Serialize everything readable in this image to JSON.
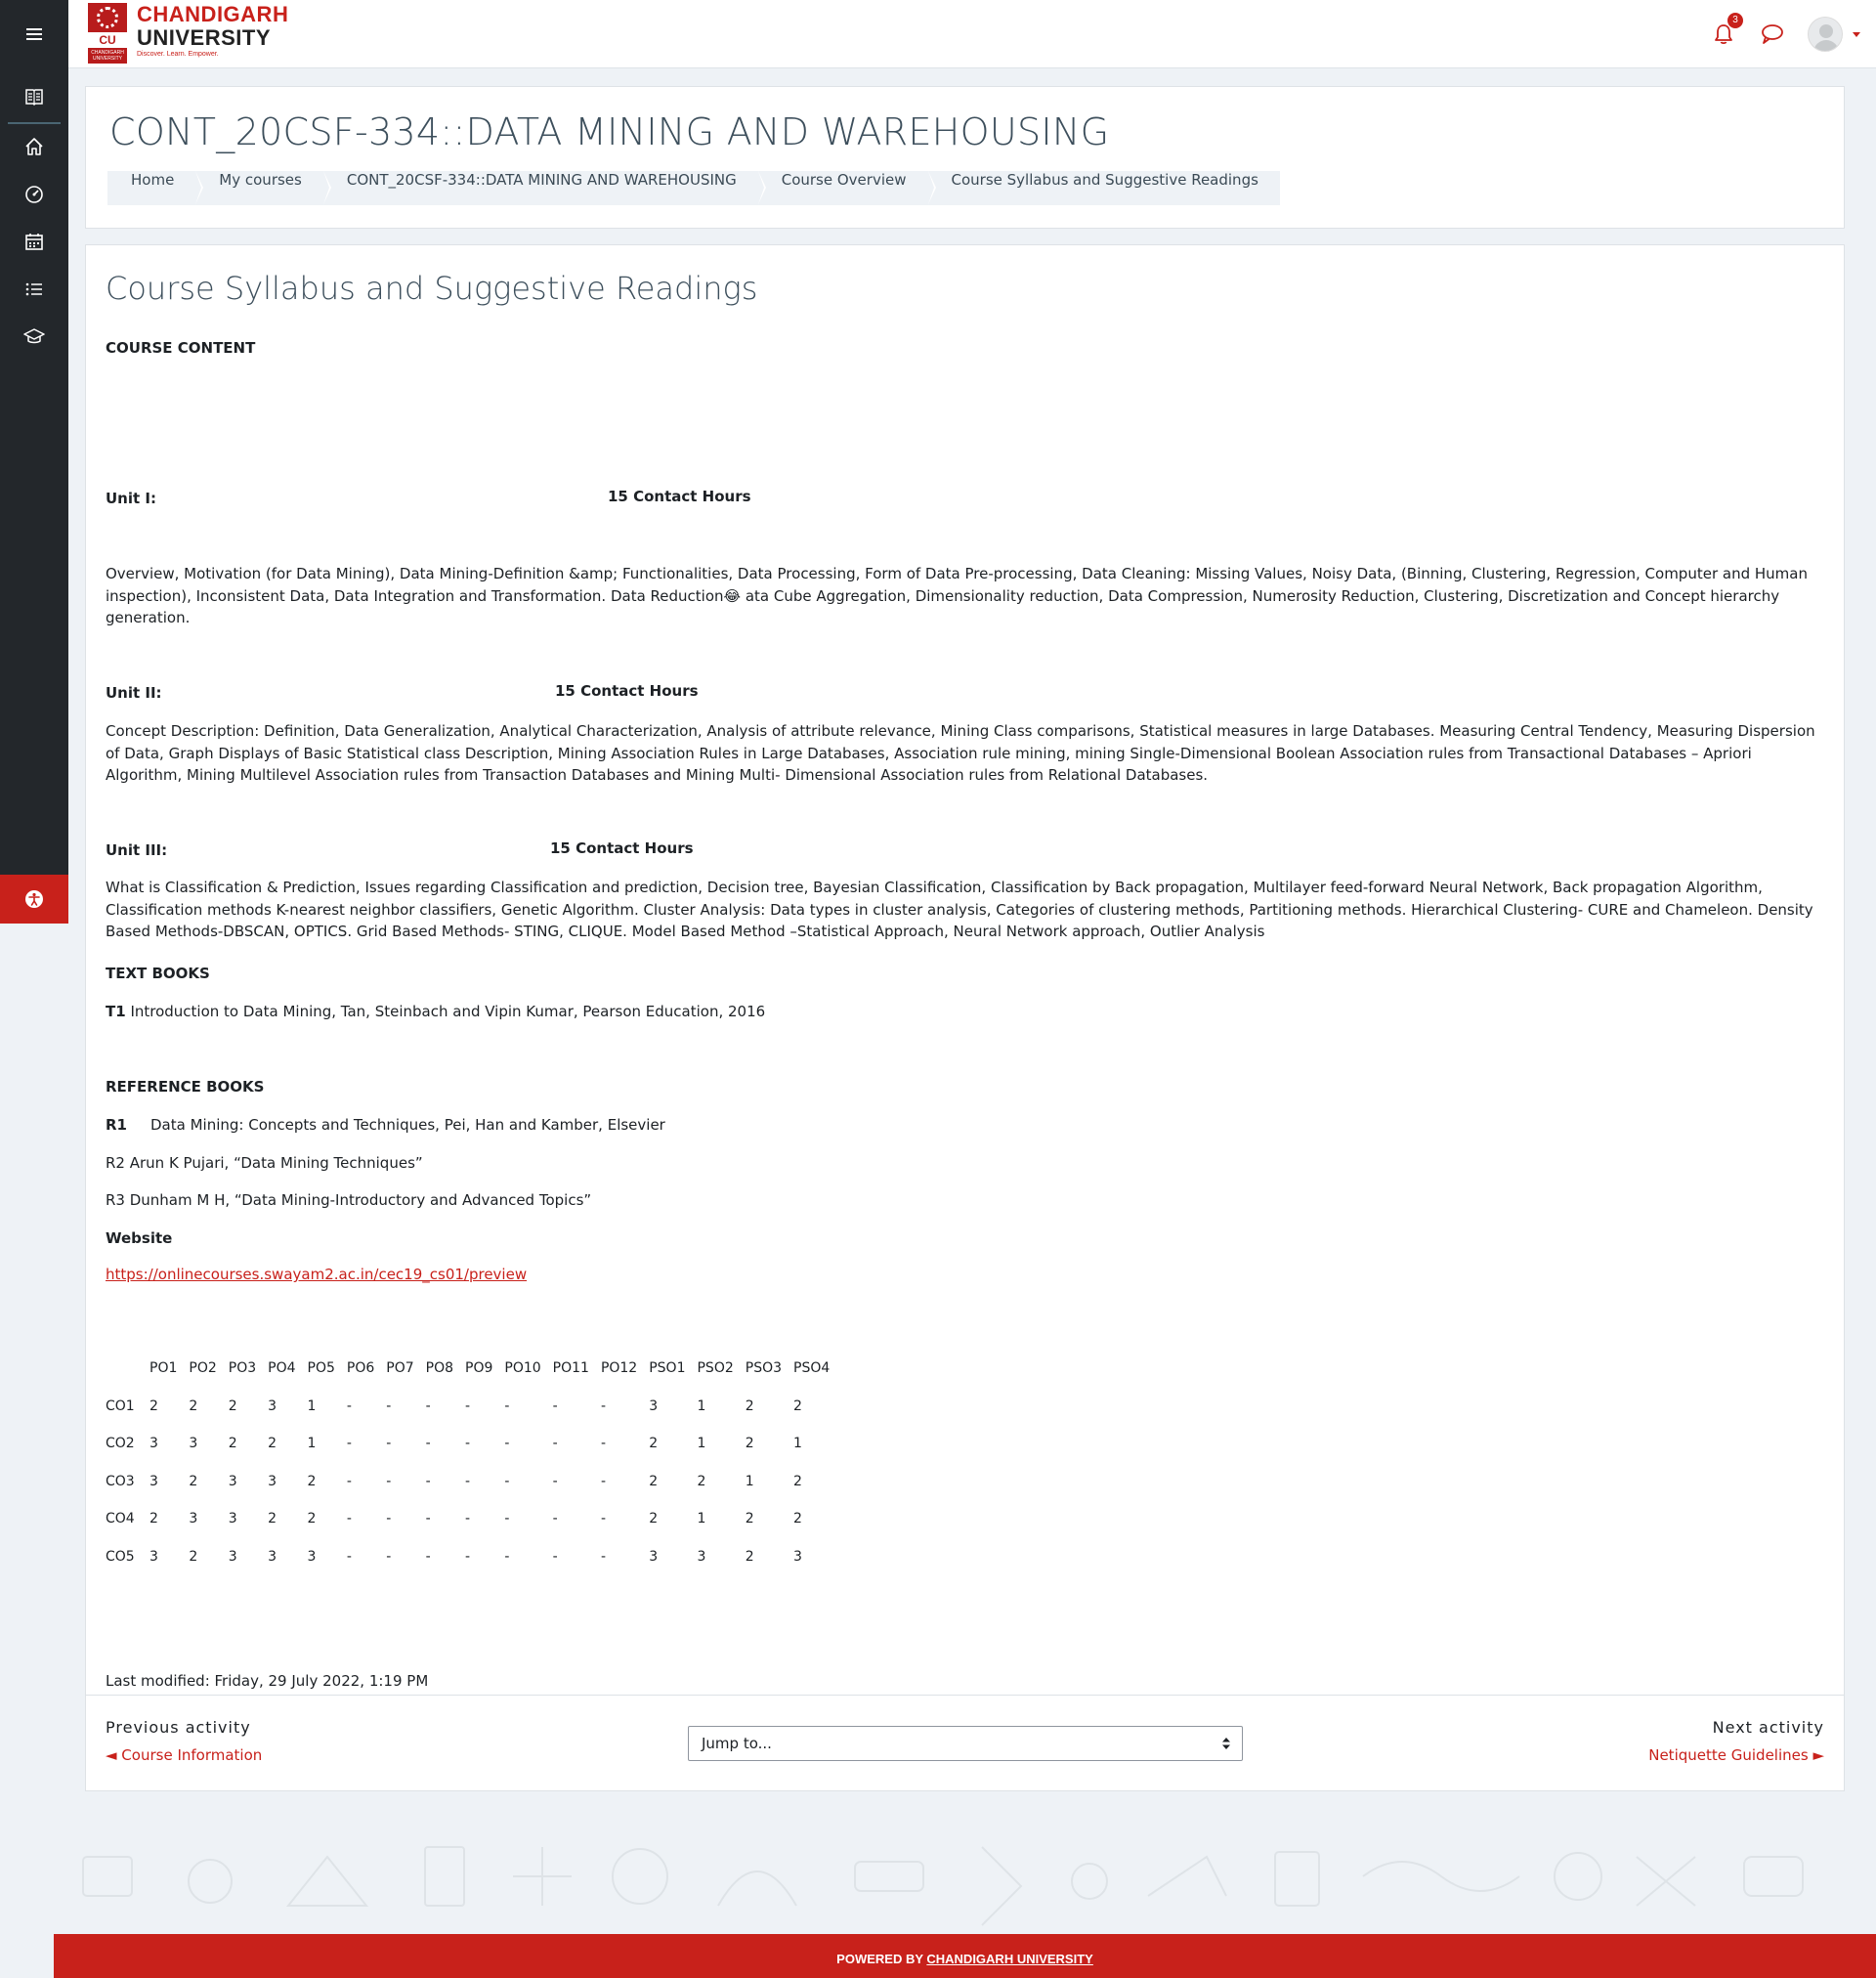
{
  "branding": {
    "line1": "CHANDIGARH",
    "line2": "UNIVERSITY",
    "tagline": "Discover. Learn. Empower.",
    "badge": "CU",
    "badge_sub": "CHANDIGARH UNIVERSITY"
  },
  "topbar": {
    "notification_count": "3",
    "icons": [
      "menu-icon",
      "bell-icon",
      "chat-bubble-icon",
      "user-avatar",
      "caret-down-icon"
    ]
  },
  "rail": {
    "icons": [
      "book-icon",
      "home-icon",
      "dashboard-gauge-icon",
      "calendar-icon",
      "list-icon",
      "graduation-cap-icon",
      "accessibility-icon"
    ]
  },
  "header": {
    "title": "CONT_20CSF-334::DATA MINING AND WAREHOUSING",
    "breadcrumb": [
      "Home",
      "My courses",
      "CONT_20CSF-334::DATA MINING AND WAREHOUSING",
      "Course Overview",
      "Course Syllabus and Suggestive Readings"
    ]
  },
  "page": {
    "title": "Course Syllabus and Suggestive Readings",
    "course_content_heading": "COURSE CONTENT",
    "units": [
      {
        "label": "Unit I:",
        "hours": "15 Contact Hours",
        "text": " Overview, Motivation (for Data Mining), Data Mining-Definition &amp; Functionalities, Data Processing, Form of Data Pre-processing, Data Cleaning: Missing Values, Noisy Data, (Binning, Clustering, Regression, Computer and Human inspection), Inconsistent Data, Data Integration and Transformation. Data Reduction😂 ata Cube Aggregation, Dimensionality reduction, Data Compression, Numerosity Reduction, Clustering, Discretization and Concept hierarchy generation."
      },
      {
        "label": "Unit II:",
        "hours": "15 Contact Hours",
        "text": " Concept Description: Definition, Data Generalization, Analytical Characterization, Analysis of attribute relevance, Mining Class comparisons, Statistical measures in large Databases. Measuring Central Tendency, Measuring Dispersion of Data, Graph Displays of Basic Statistical class Description, Mining Association Rules in Large Databases, Association rule mining, mining Single-Dimensional Boolean Association rules from Transactional Databases – Apriori Algorithm, Mining Multilevel Association rules from Transaction Databases and Mining Multi- Dimensional Association rules from Relational Databases."
      },
      {
        "label": "Unit III:",
        "hours": "15 Contact Hours",
        "text": "What is Classification & Prediction, Issues regarding Classification and prediction, Decision tree, Bayesian Classification, Classification by Back propagation, Multilayer feed-forward Neural Network, Back propagation Algorithm, Classification methods K-nearest neighbor classifiers, Genetic Algorithm. Cluster Analysis: Data types in cluster analysis, Categories of clustering methods, Partitioning methods. Hierarchical Clustering- CURE and Chameleon. Density Based Methods-DBSCAN, OPTICS. Grid Based Methods- STING, CLIQUE. Model Based Method –Statistical Approach, Neural Network approach, Outlier Analysis"
      }
    ],
    "text_books_heading": "TEXT BOOKS",
    "text_book": {
      "id": "T1",
      "text": " Introduction to Data Mining, Tan, Steinbach and Vipin Kumar, Pearson Education, 2016"
    },
    "reference_heading": "REFERENCE BOOKS",
    "references": [
      {
        "id": "R1",
        "text": "Data Mining: Concepts and Techniques, Pei, Han and Kamber, Elsevier"
      },
      {
        "id": "",
        "text": "R2 Arun K Pujari, “Data Mining Techniques”"
      },
      {
        "id": "",
        "text": "R3 Dunham M H, “Data Mining-Introductory and Advanced Topics”"
      }
    ],
    "website_heading": "Website",
    "website_url": "https://onlinecourses.swayam2.ac.in/cec19_cs01/preview",
    "mapping": {
      "headers": [
        "",
        "PO1",
        "PO2",
        "PO3",
        "PO4",
        "PO5",
        "PO6",
        "PO7",
        "PO8",
        "PO9",
        "PO10",
        "PO11",
        "PO12",
        "PSO1",
        "PSO2",
        "PSO3",
        "PSO4"
      ],
      "rows": [
        [
          "CO1",
          "2",
          "2",
          "2",
          "3",
          "1",
          "-",
          "-",
          "-",
          "-",
          "-",
          "-",
          "-",
          "3",
          "1",
          "2",
          "2"
        ],
        [
          "CO2",
          "3",
          "3",
          "2",
          "2",
          "1",
          "-",
          "-",
          "-",
          "-",
          "-",
          "-",
          "-",
          "2",
          "1",
          "2",
          "1"
        ],
        [
          "CO3",
          "3",
          "2",
          "3",
          "3",
          "2",
          "-",
          "-",
          "-",
          "-",
          "-",
          "-",
          "-",
          "2",
          "2",
          "1",
          "2"
        ],
        [
          "CO4",
          "2",
          "3",
          "3",
          "2",
          "2",
          "-",
          "-",
          "-",
          "-",
          "-",
          "-",
          "-",
          "2",
          "1",
          "2",
          "2"
        ],
        [
          "CO5",
          "3",
          "2",
          "3",
          "3",
          "3",
          "-",
          "-",
          "-",
          "-",
          "-",
          "-",
          "-",
          "3",
          "3",
          "2",
          "3"
        ]
      ]
    },
    "last_modified": "Last modified: Friday, 29 July 2022, 1:19 PM"
  },
  "activity_nav": {
    "prev_label": "Previous activity",
    "prev_link": "◄ Course Information",
    "jump_placeholder": "Jump to...",
    "next_label": "Next activity",
    "next_link": "Netiquette Guidelines ►"
  },
  "footer": {
    "prefix": "POWERED BY ",
    "link": "CHANDIGARH UNIVERSITY"
  },
  "colors": {
    "brand_red": "#c8211b",
    "sidebar_dark": "#23272b",
    "title_slate": "#3d4f5c",
    "page_bg": "#eef2f6"
  }
}
